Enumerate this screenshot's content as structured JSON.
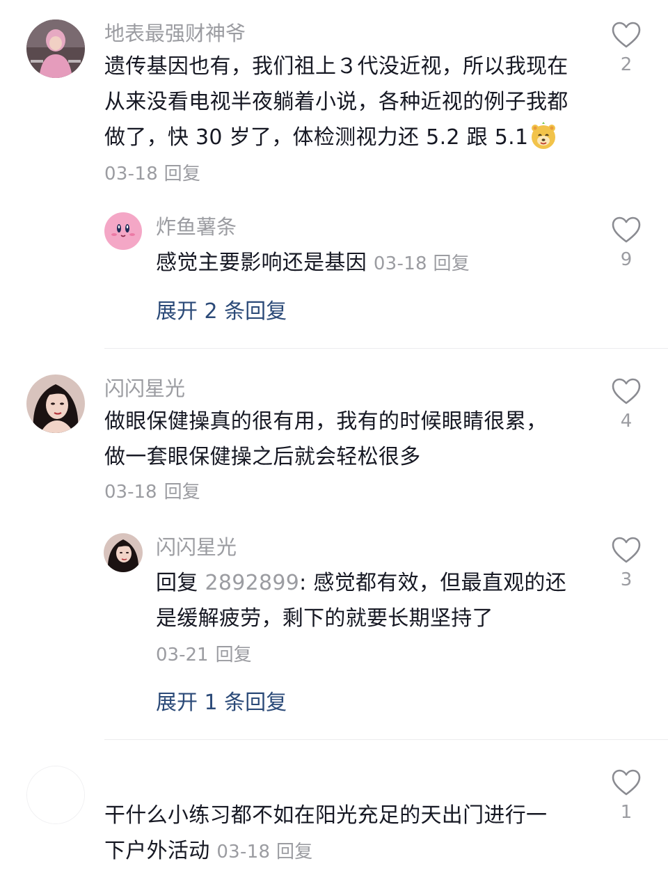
{
  "comments": [
    {
      "username": "地表最强财神爷",
      "text": "遗传基因也有，我们祖上３代没近视，所以我现在从来没看电视半夜躺着小说，各种近视的例子我都做了，快 30 岁了，体检测视力还 5.2 跟 5.1",
      "date": "03-18",
      "reply_label": "回复",
      "likes": "2",
      "emoji": "smiling-bear-emoji",
      "avatar": "person-pink-avatar",
      "replies": [
        {
          "username": "炸鱼薯条",
          "text": "感觉主要影响还是基因",
          "date": "03-18",
          "reply_label": "回复",
          "likes": "9",
          "avatar": "pink-puffball-avatar"
        }
      ],
      "expand_label": "展开 2 条回复"
    },
    {
      "username": "闪闪星光",
      "text": "做眼保健操真的很有用，我有的时候眼睛很累，做一套眼保健操之后就会轻松很多",
      "date": "03-18",
      "reply_label": "回复",
      "likes": "4",
      "avatar": "woman-dark-hair-avatar",
      "replies": [
        {
          "username": "闪闪星光",
          "reply_prefix": "回复",
          "reply_target": "2892899",
          "text": ": 感觉都有效，但最直观的还是缓解疲劳，剩下的就要长期坚持了",
          "date": "03-21",
          "reply_label": "回复",
          "likes": "3",
          "avatar": "woman-dark-hair-avatar"
        }
      ],
      "expand_label": "展开 1 条回复"
    },
    {
      "username": "",
      "text": "干什么小练习都不如在阳光充足的天出门进行一下户外活动",
      "date": "03-18",
      "reply_label": "回复",
      "likes": "1",
      "avatar": "blank-avatar"
    }
  ],
  "colors": {
    "text": "#161823",
    "muted": "#9b9ca1",
    "link": "#2b4a78",
    "divider": "#ececee"
  }
}
